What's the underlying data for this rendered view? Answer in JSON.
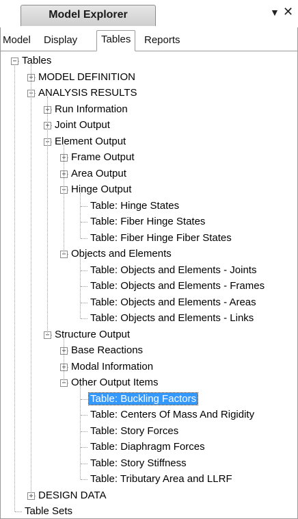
{
  "window": {
    "title": "Model Explorer",
    "dropdown_icon": "triangle-down-icon",
    "close_glyph": "✕"
  },
  "tabs": [
    {
      "label": "Model",
      "active": false
    },
    {
      "label": "Display",
      "active": false
    },
    {
      "label": "Tables",
      "active": true
    },
    {
      "label": "Reports",
      "active": false
    }
  ],
  "tree": [
    {
      "label": "Tables",
      "level": 0,
      "expander": "minus"
    },
    {
      "label": "MODEL DEFINITION",
      "level": 1,
      "expander": "plus"
    },
    {
      "label": "ANALYSIS RESULTS",
      "level": 1,
      "expander": "minus"
    },
    {
      "label": "Run Information",
      "level": 2,
      "expander": "plus"
    },
    {
      "label": "Joint Output",
      "level": 2,
      "expander": "plus"
    },
    {
      "label": "Element Output",
      "level": 2,
      "expander": "minus"
    },
    {
      "label": "Frame Output",
      "level": 3,
      "expander": "plus"
    },
    {
      "label": "Area Output",
      "level": 3,
      "expander": "plus"
    },
    {
      "label": "Hinge Output",
      "level": 3,
      "expander": "minus"
    },
    {
      "label": "Table:  Hinge States",
      "level": 4,
      "expander": "none"
    },
    {
      "label": "Table:  Fiber Hinge States",
      "level": 4,
      "expander": "none"
    },
    {
      "label": "Table:  Fiber Hinge Fiber States",
      "level": 4,
      "expander": "none"
    },
    {
      "label": "Objects and Elements",
      "level": 3,
      "expander": "minus"
    },
    {
      "label": "Table:  Objects and Elements - Joints",
      "level": 4,
      "expander": "none"
    },
    {
      "label": "Table:  Objects and Elements - Frames",
      "level": 4,
      "expander": "none"
    },
    {
      "label": "Table:  Objects and Elements - Areas",
      "level": 4,
      "expander": "none"
    },
    {
      "label": "Table:  Objects and Elements - Links",
      "level": 4,
      "expander": "none"
    },
    {
      "label": "Structure Output",
      "level": 2,
      "expander": "minus"
    },
    {
      "label": "Base Reactions",
      "level": 3,
      "expander": "plus"
    },
    {
      "label": "Modal Information",
      "level": 3,
      "expander": "plus"
    },
    {
      "label": "Other Output Items",
      "level": 3,
      "expander": "minus"
    },
    {
      "label": "Table:  Buckling Factors",
      "level": 4,
      "expander": "none",
      "selected": true
    },
    {
      "label": "Table:  Centers Of Mass And Rigidity",
      "level": 4,
      "expander": "none"
    },
    {
      "label": "Table:  Story Forces",
      "level": 4,
      "expander": "none"
    },
    {
      "label": "Table:  Diaphragm Forces",
      "level": 4,
      "expander": "none"
    },
    {
      "label": "Table:  Story Stiffness",
      "level": 4,
      "expander": "none"
    },
    {
      "label": "Table:  Tributary Area and LLRF",
      "level": 4,
      "expander": "none"
    },
    {
      "label": "DESIGN DATA",
      "level": 1,
      "expander": "plus"
    },
    {
      "label": "Table Sets",
      "level": 0,
      "expander": "none"
    }
  ]
}
